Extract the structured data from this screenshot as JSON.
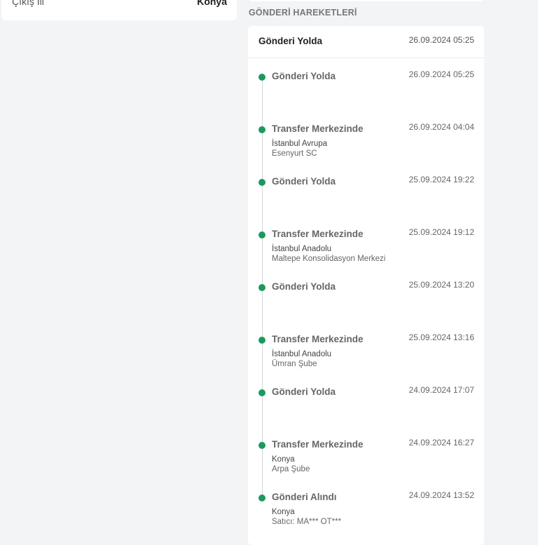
{
  "left_card": {
    "label": "Çıkış İli",
    "value": "Konya"
  },
  "section_title": "GÖNDERİ HAREKETLERİ",
  "summary": {
    "status": "Gönderi Yolda",
    "time": "26.09.2024 05:25"
  },
  "events": [
    {
      "status": "Gönderi Yolda",
      "time": "26.09.2024 05:25",
      "location": "",
      "detail": ""
    },
    {
      "status": "Transfer Merkezinde",
      "time": "26.09.2024 04:04",
      "location": "İstanbul Avrupa",
      "detail": "Esenyurt SC"
    },
    {
      "status": "Gönderi Yolda",
      "time": "25.09.2024 19:22",
      "location": "",
      "detail": ""
    },
    {
      "status": "Transfer Merkezinde",
      "time": "25.09.2024 19:12",
      "location": "İstanbul Anadolu",
      "detail": "Maltepe Konsolidasyon Merkezi"
    },
    {
      "status": "Gönderi Yolda",
      "time": "25.09.2024 13:20",
      "location": "",
      "detail": ""
    },
    {
      "status": "Transfer Merkezinde",
      "time": "25.09.2024 13:16",
      "location": "İstanbul Anadolu",
      "detail": "Ümran Şube"
    },
    {
      "status": "Gönderi Yolda",
      "time": "24.09.2024 17:07",
      "location": "",
      "detail": ""
    },
    {
      "status": "Transfer Merkezinde",
      "time": "24.09.2024 16:27",
      "location": "Konya",
      "detail": "Arpa Şube"
    },
    {
      "status": "Gönderi Alındı",
      "time": "24.09.2024 13:52",
      "location": "Konya",
      "detail": "Satıcı: MA*** OT***"
    }
  ],
  "colors": {
    "status_dot": "#1c9a5c",
    "page_background": "#f3f4f6",
    "card_background": "#ffffff"
  }
}
